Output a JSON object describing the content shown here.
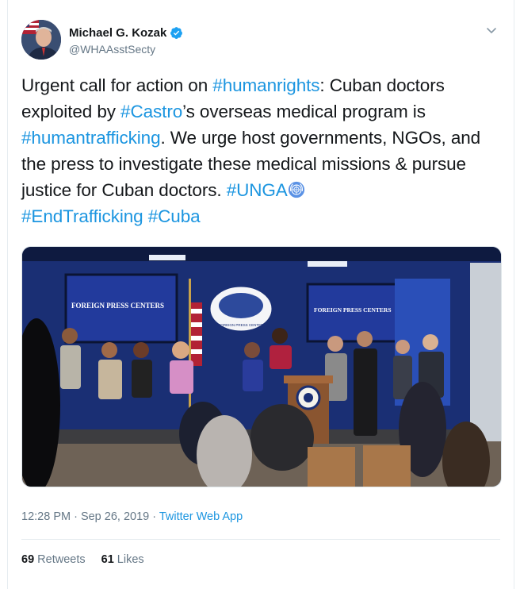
{
  "author": {
    "name": "Michael G. Kozak",
    "handle": "@WHAAsstSecty",
    "verified": true
  },
  "tweet": {
    "segments": [
      {
        "text": "Urgent call for action on ",
        "type": "text"
      },
      {
        "text": "#humanrights",
        "type": "hashtag"
      },
      {
        "text": ": Cuban doctors exploited by ",
        "type": "text"
      },
      {
        "text": "#Castro",
        "type": "hashtag"
      },
      {
        "text": "’s overseas medical program is ",
        "type": "text"
      },
      {
        "text": "#humantrafficking",
        "type": "hashtag"
      },
      {
        "text": ". We urge host governments, NGOs, and the press to investigate these medical missions & pursue justice for Cuban doctors. ",
        "type": "text"
      },
      {
        "text": "#UNGA",
        "type": "hashtag"
      },
      {
        "text": "#EndTrafficking",
        "type": "hashtag"
      },
      {
        "text": " ",
        "type": "text"
      },
      {
        "text": "#Cuba",
        "type": "hashtag"
      }
    ]
  },
  "media": {
    "screen_left": "FOREIGN PRESS CENTERS",
    "screen_right": "FOREIGN PRESS CENTERS",
    "seal_text": "FOREIGN PRESS CENTER"
  },
  "meta": {
    "time": "12:28 PM · Sep 26, 2019 · ",
    "app": "Twitter Web App"
  },
  "stats": {
    "retweets_count": "69",
    "retweets_label": "Retweets",
    "likes_count": "61",
    "likes_label": "Likes"
  },
  "colors": {
    "link": "#1b95e0",
    "text": "#14171a",
    "muted": "#657786"
  },
  "icons": {
    "verified": "verified-badge-icon",
    "caret": "chevron-down-icon",
    "un": "united-nations-emblem-icon"
  }
}
